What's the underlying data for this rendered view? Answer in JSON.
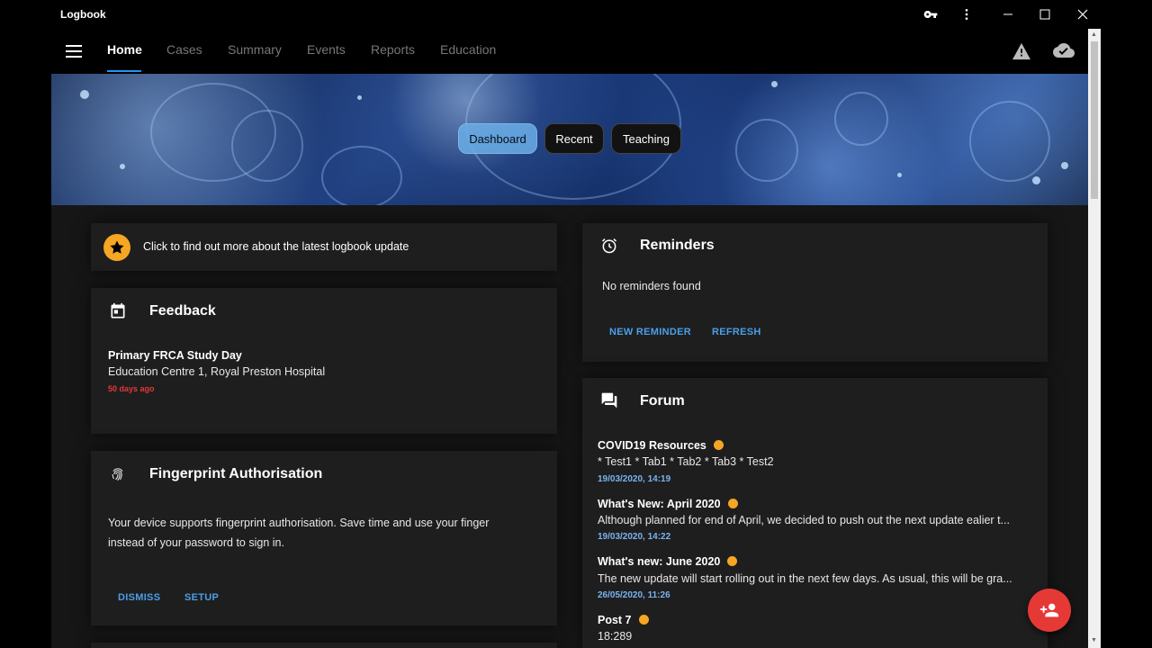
{
  "window": {
    "title": "Logbook",
    "controls": {
      "key_icon": "key-icon",
      "more_icon": "more-vert-icon",
      "minimize": "minimize-icon",
      "maximize": "maximize-icon",
      "close": "close-icon"
    }
  },
  "nav": {
    "tabs": [
      {
        "label": "Home",
        "active": true
      },
      {
        "label": "Cases",
        "active": false
      },
      {
        "label": "Summary",
        "active": false
      },
      {
        "label": "Events",
        "active": false
      },
      {
        "label": "Reports",
        "active": false
      },
      {
        "label": "Education",
        "active": false
      }
    ],
    "right_icons": [
      "warning-icon",
      "cloud-done-icon"
    ]
  },
  "banner": {
    "chips": [
      {
        "label": "Dashboard",
        "selected": true
      },
      {
        "label": "Recent",
        "selected": false
      },
      {
        "label": "Teaching",
        "selected": false
      }
    ]
  },
  "update_card": {
    "icon": "star-icon",
    "text": "Click to find out more about the latest logbook update"
  },
  "feedback": {
    "title": "Feedback",
    "icon": "event-icon",
    "item_title": "Primary FRCA Study Day",
    "item_location": "Education Centre 1, Royal Preston Hospital",
    "item_age": "50 days ago"
  },
  "fingerprint": {
    "title": "Fingerprint Authorisation",
    "icon": "fingerprint-icon",
    "body_line1": "Your device supports fingerprint authorisation. Save time and use your finger",
    "body_line2": "instead of your password to sign in.",
    "dismiss": "DISMISS",
    "setup": "SETUP"
  },
  "reminders": {
    "title": "Reminders",
    "icon": "alarm-icon",
    "empty_text": "No reminders found",
    "new_reminder": "NEW REMINDER",
    "refresh": "REFRESH"
  },
  "forum": {
    "title": "Forum",
    "icon": "forum-icon",
    "posts": [
      {
        "title": "COVID19 Resources",
        "body": "* Test1 * Tab1 * Tab2 * Tab3 * Test2",
        "date": "19/03/2020, 14:19"
      },
      {
        "title": "What's New: April 2020",
        "body": "Although planned for end of April, we decided to push out the next update ealier t...",
        "date": "19/03/2020, 14:22"
      },
      {
        "title": "What's new: June 2020",
        "body": "The new update will start rolling out in the next few days. As usual, this will be gra...",
        "date": "26/05/2020, 11:26"
      },
      {
        "title": "Post 7",
        "body": "18:289",
        "date": ""
      }
    ]
  },
  "fab": {
    "icon": "person-add-icon"
  },
  "colors": {
    "accent": "#2196f3",
    "link": "#4b9fe8",
    "fab": "#e53935",
    "unread_dot": "#f5a623",
    "age_text": "#e53935"
  }
}
